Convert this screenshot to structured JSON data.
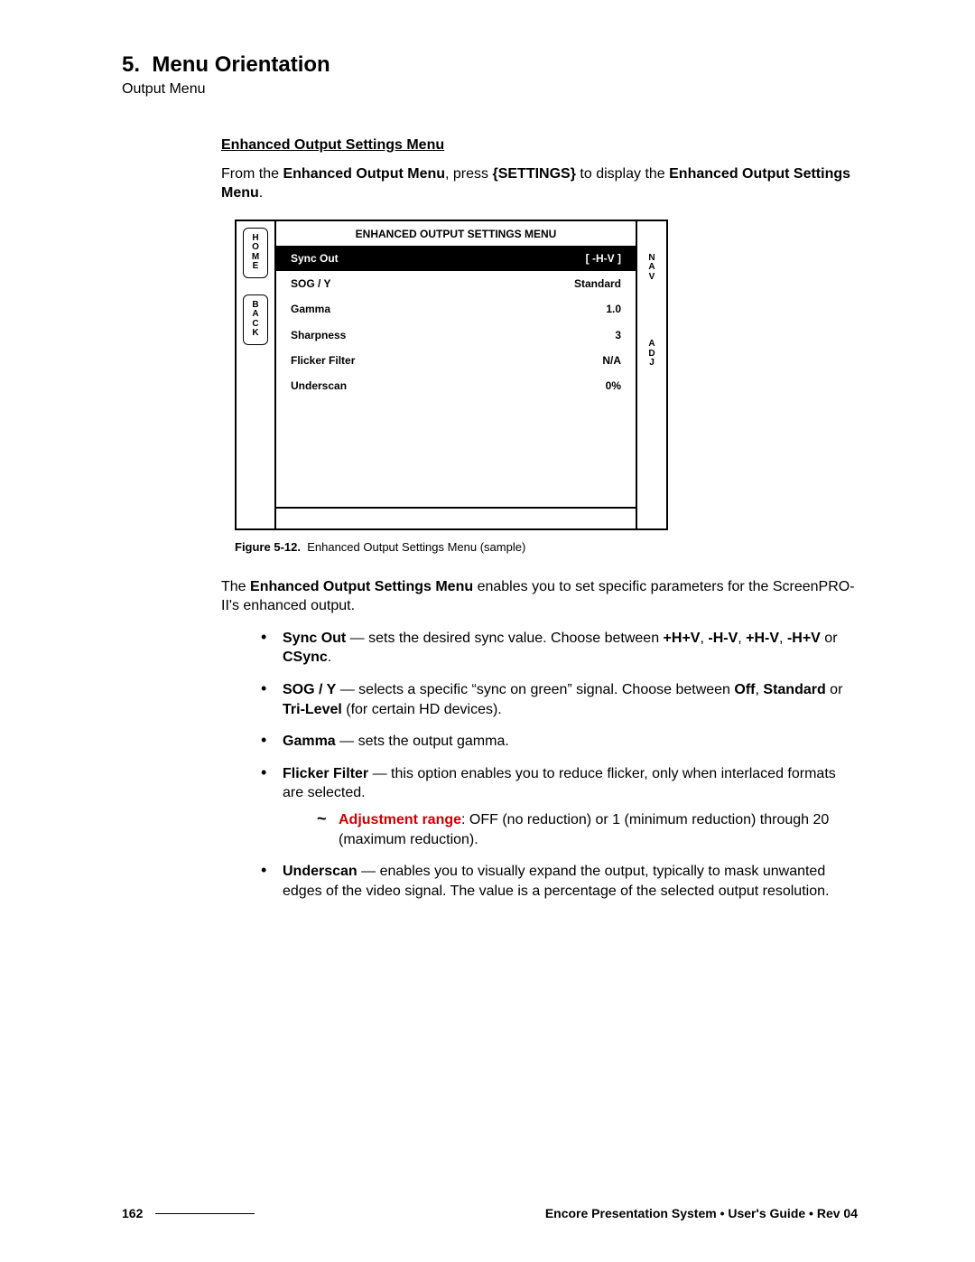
{
  "chapter": {
    "number": "5.",
    "title": "Menu Orientation",
    "subtitle": "Output Menu"
  },
  "section_heading": "Enhanced Output Settings Menu",
  "intro": {
    "t1": "From the ",
    "b1": "Enhanced Output Menu",
    "t2": ", press ",
    "b2": "{SETTINGS}",
    "t3": " to display the ",
    "b3": "Enhanced Output Settings Menu",
    "t4": "."
  },
  "menu": {
    "title": "ENHANCED OUTPUT SETTINGS MENU",
    "left_buttons": [
      "HOME",
      "BACK"
    ],
    "right_labels": [
      "NAV",
      "ADJ"
    ],
    "rows": [
      {
        "label": "Sync Out",
        "value": "[  -H-V ]",
        "selected": true
      },
      {
        "label": "SOG / Y",
        "value": "Standard",
        "selected": false
      },
      {
        "label": "Gamma",
        "value": "1.0",
        "selected": false
      },
      {
        "label": "Sharpness",
        "value": "3",
        "selected": false
      },
      {
        "label": "Flicker Filter",
        "value": "N/A",
        "selected": false
      },
      {
        "label": "Underscan",
        "value": "0%",
        "selected": false
      }
    ]
  },
  "figure": {
    "number": "Figure 5-12.",
    "caption": "Enhanced Output Settings Menu  (sample)"
  },
  "desc": {
    "t1": "The ",
    "b1": "Enhanced Output Settings Menu",
    "t2": " enables you to set specific parameters for the ScreenPRO-II's enhanced output."
  },
  "bullets": {
    "sync_out": {
      "label": "Sync Out",
      "t1": " — sets the desired sync value.  Choose between ",
      "o1": "+H+V",
      "c1": ", ",
      "o2": "-H-V",
      "c2": ", ",
      "o3": "+H-V",
      "c3": ", ",
      "o4": "-H+V",
      "t2": " or ",
      "o5": "CSync",
      "t3": "."
    },
    "sog": {
      "label": "SOG / Y",
      "t1": " — selects a specific “sync on green” signal.  Choose between ",
      "o1": "Off",
      "c1": ", ",
      "o2": "Standard",
      "t2": " or ",
      "o3": "Tri-Level",
      "t3": " (for certain HD devices)."
    },
    "gamma": {
      "label": "Gamma",
      "t1": " — sets the output gamma."
    },
    "flicker": {
      "label": "Flicker Filter",
      "t1": " — this option enables you to reduce flicker, only when interlaced formats are selected.",
      "sub_label": "Adjustment range",
      "sub_text": ":  OFF (no reduction) or 1 (minimum reduction) through 20 (maximum reduction)."
    },
    "underscan": {
      "label": "Underscan",
      "t1": " — enables you to visually expand the output, typically to mask unwanted edges of the video signal.  The value is a percentage of the selected output resolution."
    }
  },
  "footer": {
    "page": "162",
    "text": "Encore Presentation System  •  User's Guide  •  Rev 04"
  }
}
